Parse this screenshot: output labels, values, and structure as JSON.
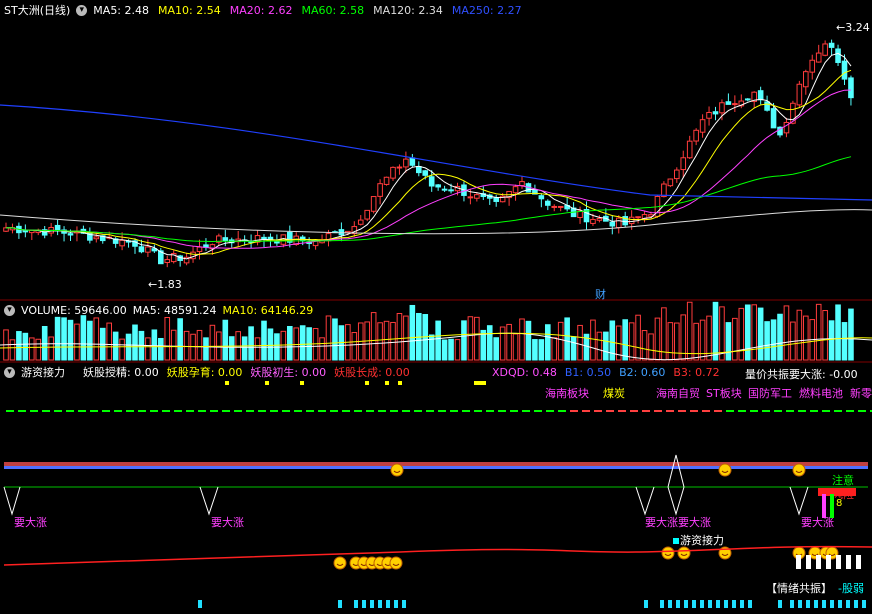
{
  "main": {
    "title": "ST大洲(日线)",
    "ma": [
      {
        "name": "MA5",
        "value": "2.48",
        "color": "#ffffff"
      },
      {
        "name": "MA10",
        "value": "2.54",
        "color": "#ffff00"
      },
      {
        "name": "MA20",
        "value": "2.62",
        "color": "#ff40ff"
      },
      {
        "name": "MA60",
        "value": "2.58",
        "color": "#00ff00"
      },
      {
        "name": "MA120",
        "value": "2.34",
        "color": "#dddddd"
      },
      {
        "name": "MA250",
        "value": "2.27",
        "color": "#3050ff"
      }
    ],
    "high_label": "3.24",
    "low_label": "1.83",
    "marker": "财"
  },
  "volume": {
    "label": "VOLUME",
    "value": "59646.00",
    "ma5_label": "MA5",
    "ma5": "48591.24",
    "ma10_label": "MA10",
    "ma10": "64146.29"
  },
  "indicator": {
    "name": "游资接力",
    "items": [
      {
        "text": "妖股授精: 0.00",
        "color": "#ffffff"
      },
      {
        "text": "妖股孕育: 0.00",
        "color": "#ffff00"
      },
      {
        "text": "妖股初生: 0.00",
        "color": "#ff60ff"
      },
      {
        "text": "妖股长成: 0.00",
        "color": "#ff3030"
      }
    ],
    "right_items": [
      {
        "text": "XDQD: 0.48",
        "color": "#ff50ff"
      },
      {
        "text": "B1: 0.50",
        "color": "#3060ff"
      },
      {
        "text": "B2: 0.60",
        "color": "#40a0ff"
      },
      {
        "text": "B3: 0.72",
        "color": "#ff3030"
      }
    ],
    "right_title": "量价共振要大涨: -0.00",
    "sector_tags": [
      {
        "text": "海南板块",
        "color": "#ff40ff"
      },
      {
        "text": "煤炭",
        "color": "#ffff00"
      },
      {
        "text": "海南自贸",
        "color": "#ff40ff"
      },
      {
        "text": "ST板块",
        "color": "#ff40ff"
      },
      {
        "text": "国防军工",
        "color": "#ff40ff"
      },
      {
        "text": "燃料电池",
        "color": "#ff40ff"
      },
      {
        "text": "新零",
        "color": "#ff40ff"
      }
    ],
    "signal_label": "要大涨",
    "notice": "注意",
    "risk": "风险",
    "num_label": "8",
    "relay_label": "游资接力",
    "sentiment_left": "【情绪共振】",
    "sentiment_right": "-股弱"
  }
}
